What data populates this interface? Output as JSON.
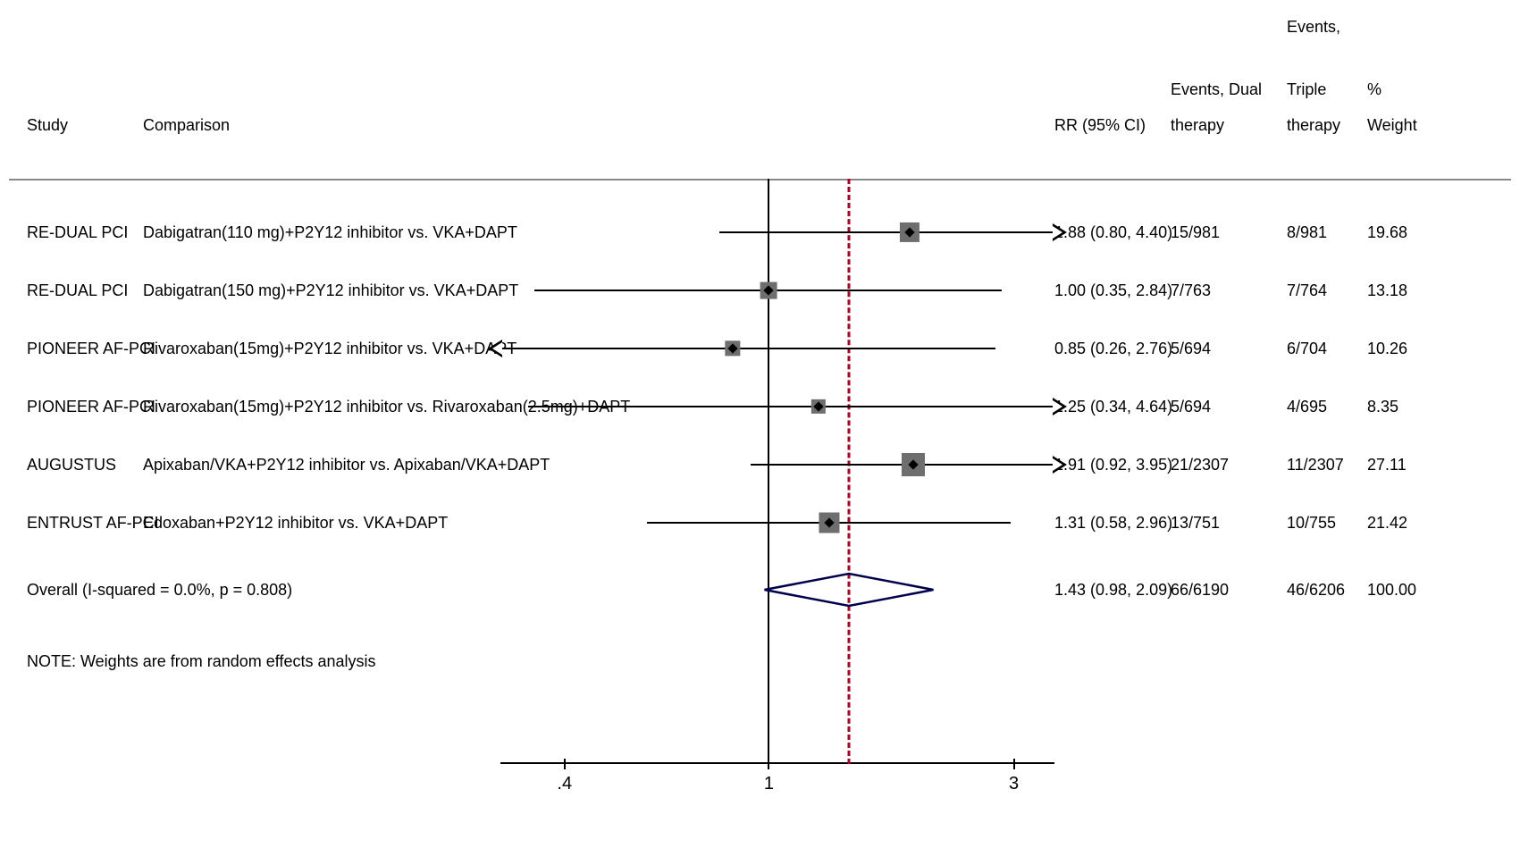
{
  "headers": {
    "study": "Study",
    "comparison": "Comparison",
    "rr": "RR (95% CI)",
    "dual_a": "Events, Dual",
    "dual_b": "therapy",
    "trip_a": "Events,",
    "trip_b": "Triple",
    "trip_c": "therapy",
    "pct": "%",
    "weight": "Weight"
  },
  "axis": {
    "t1": ".4",
    "t2": "1",
    "t3": "3"
  },
  "overall": {
    "label": "Overall  (I-squared = 0.0%, p = 0.808)",
    "rr": "1.43 (0.98, 2.09)",
    "dual": "66/6190",
    "trip": "46/6206",
    "wt": "100.00"
  },
  "note": "NOTE: Weights are from random effects analysis",
  "rows": [
    {
      "study": "RE-DUAL PCI",
      "comparison": "Dabigatran(110 mg)+P2Y12 inhibitor vs. VKA+DAPT",
      "rr": "1.88 (0.80, 4.40)",
      "dual": "15/981",
      "trip": "8/981",
      "wt": "19.68"
    },
    {
      "study": "RE-DUAL PCI",
      "comparison": "Dabigatran(150 mg)+P2Y12 inhibitor vs. VKA+DAPT",
      "rr": "1.00 (0.35, 2.84)",
      "dual": "7/763",
      "trip": "7/764",
      "wt": "13.18"
    },
    {
      "study": "PIONEER AF-PCI",
      "comparison": "Rivaroxaban(15mg)+P2Y12 inhibitor vs. VKA+DAPT",
      "rr": "0.85 (0.26, 2.76)",
      "dual": "5/694",
      "trip": "6/704",
      "wt": "10.26"
    },
    {
      "study": "PIONEER AF-PCI",
      "comparison": "Rivaroxaban(15mg)+P2Y12 inhibitor vs. Rivaroxaban(2.5mg)+DAPT",
      "rr": "1.25 (0.34, 4.64)",
      "dual": "5/694",
      "trip": "4/695",
      "wt": "8.35"
    },
    {
      "study": "AUGUSTUS",
      "comparison": "Apixaban/VKA+P2Y12 inhibitor vs. Apixaban/VKA+DAPT",
      "rr": "1.91 (0.92, 3.95)",
      "dual": "21/2307",
      "trip": "11/2307",
      "wt": "27.11"
    },
    {
      "study": "ENTRUST AF-PCI",
      "comparison": "Edoxaban+P2Y12 inhibitor vs. VKA+DAPT",
      "rr": "1.31 (0.58, 2.96)",
      "dual": "13/751",
      "trip": "10/755",
      "wt": "21.42"
    }
  ],
  "chart_data": {
    "type": "forest",
    "title": "",
    "xlabel": "RR (95% CI)",
    "ylabel": "",
    "x_scale": "log",
    "x_ticks": [
      0.4,
      1,
      3
    ],
    "reference_line": 1.0,
    "pooled_line": 1.43,
    "series": [
      {
        "name": "RE-DUAL PCI — Dabigatran(110 mg)+P2Y12 inhibitor vs. VKA+DAPT",
        "rr": 1.88,
        "low": 0.8,
        "high": 4.4,
        "events_dual": "15/981",
        "events_triple": "8/981",
        "weight": 19.68
      },
      {
        "name": "RE-DUAL PCI — Dabigatran(150 mg)+P2Y12 inhibitor vs. VKA+DAPT",
        "rr": 1.0,
        "low": 0.35,
        "high": 2.84,
        "events_dual": "7/763",
        "events_triple": "7/764",
        "weight": 13.18
      },
      {
        "name": "PIONEER AF-PCI — Rivaroxaban(15mg)+P2Y12 inhibitor vs. VKA+DAPT",
        "rr": 0.85,
        "low": 0.26,
        "high": 2.76,
        "events_dual": "5/694",
        "events_triple": "6/704",
        "weight": 10.26
      },
      {
        "name": "PIONEER AF-PCI — Rivaroxaban(15mg)+P2Y12 inhibitor vs. Rivaroxaban(2.5mg)+DAPT",
        "rr": 1.25,
        "low": 0.34,
        "high": 4.64,
        "events_dual": "5/694",
        "events_triple": "4/695",
        "weight": 8.35
      },
      {
        "name": "AUGUSTUS — Apixaban/VKA+P2Y12 inhibitor vs. Apixaban/VKA+DAPT",
        "rr": 1.91,
        "low": 0.92,
        "high": 3.95,
        "events_dual": "21/2307",
        "events_triple": "11/2307",
        "weight": 27.11
      },
      {
        "name": "ENTRUST AF-PCI — Edoxaban+P2Y12 inhibitor vs. VKA+DAPT",
        "rr": 1.31,
        "low": 0.58,
        "high": 2.96,
        "events_dual": "13/751",
        "events_triple": "10/755",
        "weight": 21.42
      }
    ],
    "overall": {
      "rr": 1.43,
      "low": 0.98,
      "high": 2.09,
      "weight": 100.0,
      "i_squared": 0.0,
      "p": 0.808
    }
  }
}
